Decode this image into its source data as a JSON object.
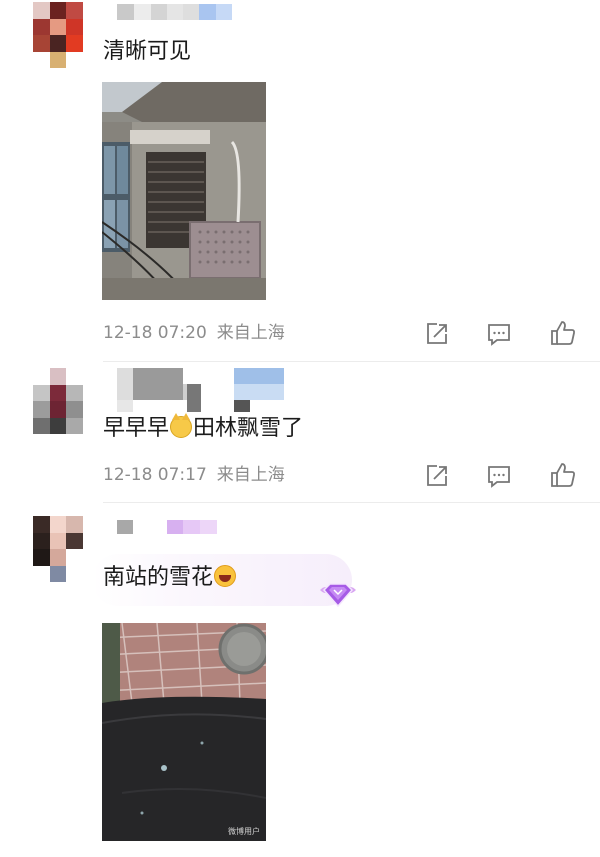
{
  "comments": [
    {
      "text": "清晰可见",
      "time": "12-18 07:20",
      "location": "来自上海"
    },
    {
      "text_before": "早早早",
      "text_after": "田林飘雪了",
      "time": "12-18 07:17",
      "location": "来自上海"
    },
    {
      "text": "南站的雪花",
      "photo_watermark": "微博用户"
    }
  ],
  "icons": {
    "share": "share-icon",
    "comment": "comment-icon",
    "like": "like-icon",
    "badge": "diamond-badge-icon"
  }
}
